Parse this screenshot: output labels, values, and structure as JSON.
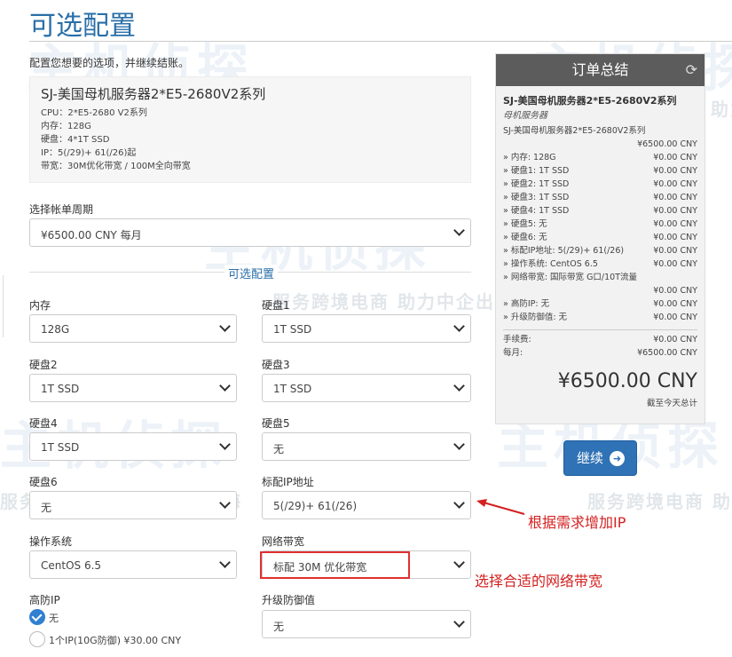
{
  "page": {
    "title": "可选配置",
    "intro": "配置您想要的选项，并继续结账。"
  },
  "product": {
    "name": "SJ-美国母机服务器2*E5-2680V2系列",
    "lines": [
      "CPU：2*E5-2680 V2系列",
      "内存：128G",
      "硬盘：4*1T SSD",
      "IP：5(/29)+ 61(/26)起",
      "带宽：30M优化带宽 / 100M全向带宽"
    ]
  },
  "billing": {
    "label": "选择帐单周期",
    "value": "¥6500.00 CNY 每月"
  },
  "config": {
    "section_title": "可选配置",
    "fields": {
      "memory": {
        "label": "内存",
        "value": "128G"
      },
      "disk1": {
        "label": "硬盘1",
        "value": "1T SSD"
      },
      "disk2": {
        "label": "硬盘2",
        "value": "1T SSD"
      },
      "disk3": {
        "label": "硬盘3",
        "value": "1T SSD"
      },
      "disk4": {
        "label": "硬盘4",
        "value": "1T SSD"
      },
      "disk5": {
        "label": "硬盘5",
        "value": "无"
      },
      "disk6": {
        "label": "硬盘6",
        "value": "无"
      },
      "ip": {
        "label": "标配IP地址",
        "value": "5(/29)+ 61(/26)"
      },
      "os": {
        "label": "操作系统",
        "value": "CentOS 6.5"
      },
      "bandwidth": {
        "label": "网络带宽",
        "value": "标配 30M 优化带宽"
      },
      "upgrade_defense": {
        "label": "升级防御值",
        "value": "无"
      }
    },
    "ddos_ip": {
      "label": "高防IP",
      "options": [
        {
          "label": "无",
          "selected": true
        },
        {
          "label": "1个IP(10G防御) ¥30.00 CNY",
          "selected": false
        }
      ]
    }
  },
  "summary": {
    "title": "订单总结",
    "refresh_icon": "refresh-icon",
    "product_name": "SJ-美国母机服务器2*E5-2680V2系列",
    "group": "母机服务器",
    "product_line": "SJ-美国母机服务器2*E5-2680V2系列",
    "base_price": "¥6500.00 CNY",
    "items": [
      {
        "label": "» 内存: 128G",
        "value": "¥0.00 CNY"
      },
      {
        "label": "» 硬盘1: 1T SSD",
        "value": "¥0.00 CNY"
      },
      {
        "label": "» 硬盘2: 1T SSD",
        "value": "¥0.00 CNY"
      },
      {
        "label": "» 硬盘3: 1T SSD",
        "value": "¥0.00 CNY"
      },
      {
        "label": "» 硬盘4: 1T SSD",
        "value": "¥0.00 CNY"
      },
      {
        "label": "» 硬盘5: 无",
        "value": "¥0.00 CNY"
      },
      {
        "label": "» 硬盘6: 无",
        "value": "¥0.00 CNY"
      },
      {
        "label": "» 标配IP地址: 5(/29)+ 61(/26)",
        "value": "¥0.00 CNY"
      },
      {
        "label": "» 操作系统: CentOS 6.5",
        "value": "¥0.00 CNY"
      },
      {
        "label": "» 网络带宽: 国际带宽 G口/10T流量",
        "value": ""
      },
      {
        "label": "",
        "value": "¥0.00 CNY"
      },
      {
        "label": "» 高防IP: 无",
        "value": "¥0.00 CNY"
      },
      {
        "label": "» 升级防御值: 无",
        "value": "¥0.00 CNY"
      }
    ],
    "setup_label": "手续费:",
    "setup_value": "¥0.00 CNY",
    "monthly_label": "每月:",
    "monthly_value": "¥6500.00 CNY",
    "total": "¥6500.00 CNY",
    "due_today": "截至今天总计"
  },
  "continue_button": {
    "label": "继续",
    "icon": "arrow-right-circle-icon"
  },
  "annotations": {
    "ip_note": "根据需求增加IP",
    "bandwidth_note": "选择合适的网络带宽",
    "color": "#d42020"
  },
  "watermark": {
    "brand": "主机侦探",
    "slogan": "服务跨境电商 助力中企出海"
  }
}
